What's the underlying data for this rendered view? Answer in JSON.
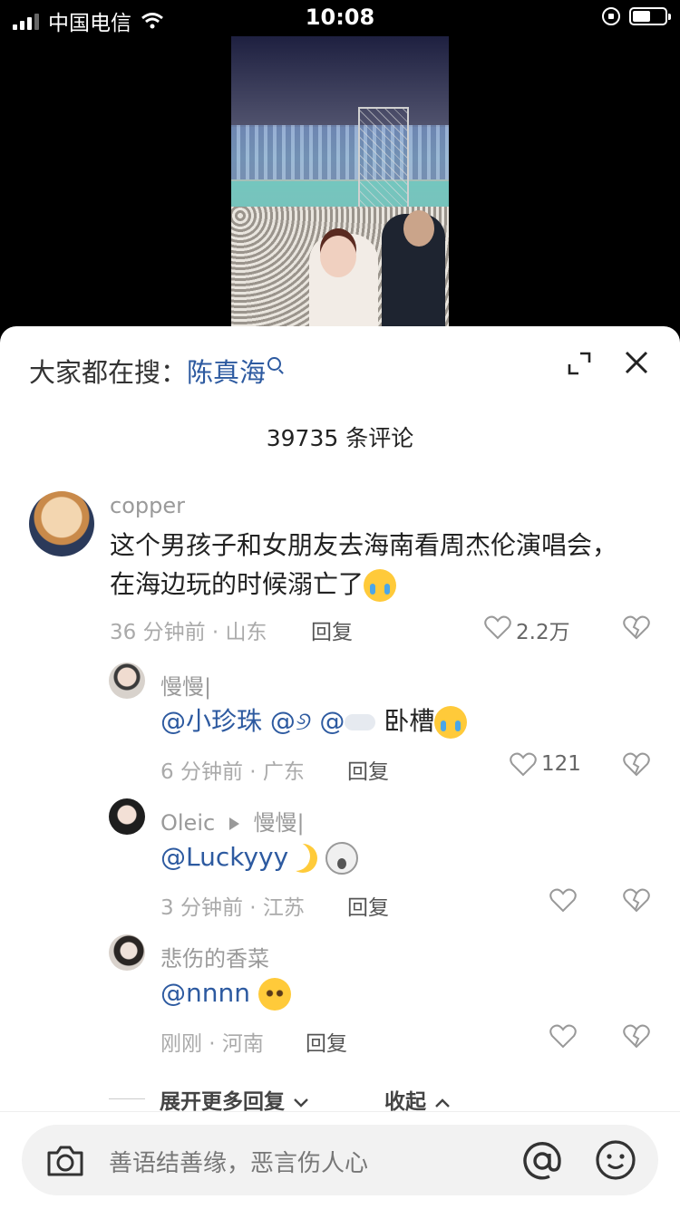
{
  "status_bar": {
    "carrier": "中国电信",
    "time": "10:08",
    "battery_level": 0.55
  },
  "sheet": {
    "search_prefix": "大家都在搜：",
    "search_term": "陈真海",
    "comment_count": "39735 条评论"
  },
  "comments": [
    {
      "username": "copper",
      "text": "这个男孩子和女朋友去海南看周杰伦演唱会，在海边玩的时候溺亡了",
      "emoji": "crying-face",
      "meta": "36 分钟前 · 山东",
      "reply_label": "回复",
      "likes": "2.2万"
    }
  ],
  "replies": [
    {
      "username": "慢慢|",
      "mention1": "@小珍珠",
      "mention2": "@୬",
      "mention3": "@",
      "text": "卧槽",
      "emoji": "crying-face",
      "meta": "6 分钟前 · 广东",
      "reply_label": "回复",
      "likes": "121"
    },
    {
      "username": "Oleic",
      "reply_to": "慢慢|",
      "mention1": "@Luckyyy",
      "emoji": "shocked-face",
      "meta": "3 分钟前 · 江苏",
      "reply_label": "回复",
      "likes": ""
    },
    {
      "username": "悲伤的香菜",
      "mention1": "@nnnn",
      "emoji": "pleading-face",
      "meta": "刚刚 · 河南",
      "reply_label": "回复",
      "likes": ""
    }
  ],
  "thread_controls": {
    "expand_more": "展开更多回复",
    "collapse": "收起"
  },
  "input": {
    "placeholder": "善语结善缘，恶言伤人心"
  },
  "colors": {
    "link": "#2d5aa0",
    "meta": "#aaaaaa"
  }
}
